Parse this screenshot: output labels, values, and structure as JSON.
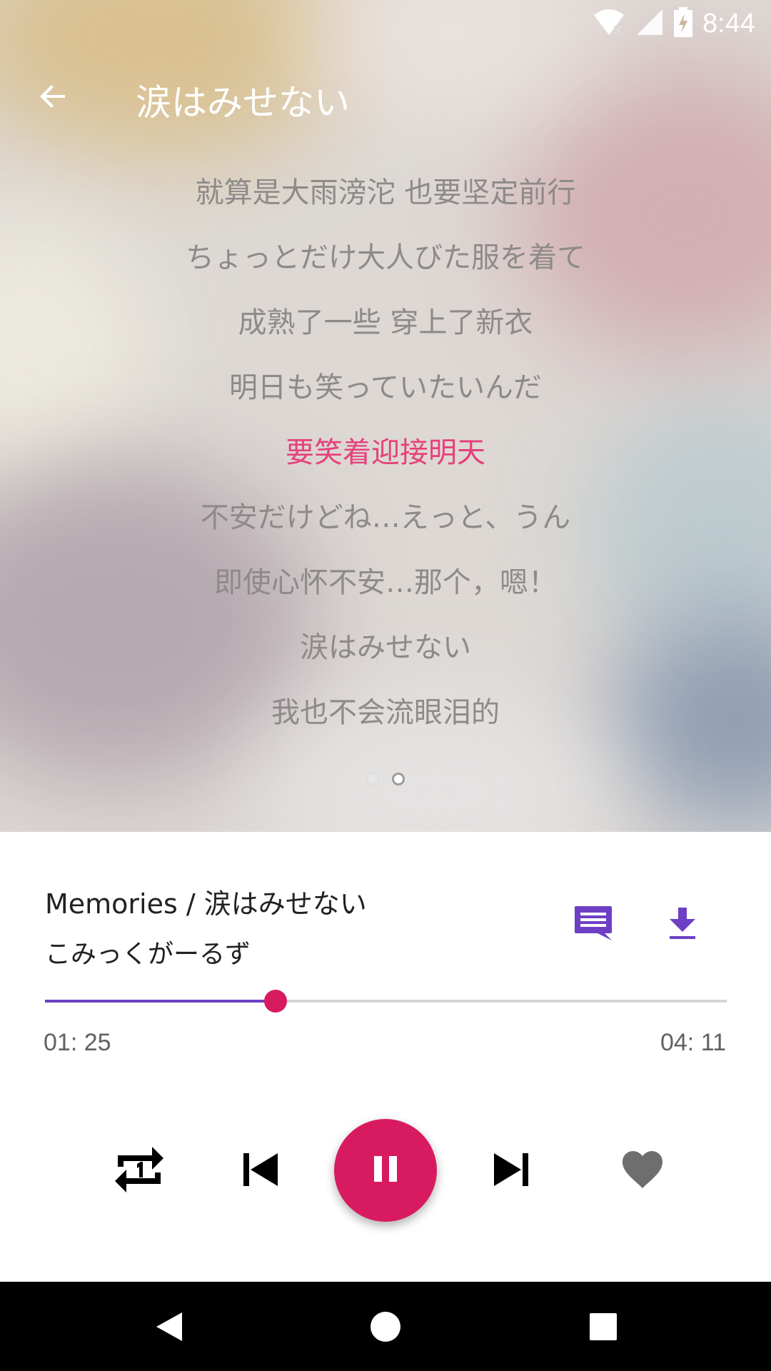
{
  "status_bar": {
    "time": "8:44",
    "icons": [
      "wifi-icon",
      "signal-icon",
      "battery-charging-icon"
    ]
  },
  "app_bar": {
    "title": "涙はみせない",
    "back_icon": "arrow-back-icon"
  },
  "lyrics": {
    "lines": [
      "就算是大雨滂沱 也要坚定前行",
      "ちょっとだけ大人びた服を着て",
      "成熟了一些 穿上了新衣",
      "明日も笑っていたいんだ",
      "要笑着迎接明天",
      "不安だけどね…えっと、うん",
      "即使心怀不安…那个，嗯！",
      "涙はみせない",
      "我也不会流眼泪的"
    ],
    "active_index": 4
  },
  "pager": {
    "pages": 2,
    "current": 2
  },
  "player": {
    "song_title": "Memories / 涙はみせない",
    "artist": "こみっくがーるず",
    "current_time": "01: 25",
    "total_time": "04: 11",
    "progress": 0.338
  },
  "colors": {
    "accent": "#d81b60",
    "primary": "#6d3fc4",
    "active_lyric": "#e6407b",
    "lyric": "#8d8a89"
  }
}
